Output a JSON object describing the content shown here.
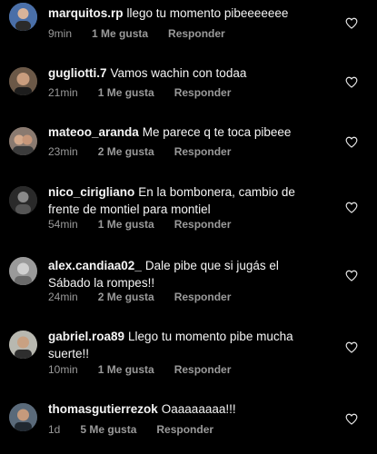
{
  "comments": [
    {
      "username": "marquitos.rp",
      "text": "llego tu momento pibeeeeeee",
      "time": "9min",
      "likes": "1 Me gusta",
      "reply": "Responder"
    },
    {
      "username": "gugliotti.7",
      "text": "Vamos wachin con todaa",
      "time": "21min",
      "likes": "1 Me gusta",
      "reply": "Responder"
    },
    {
      "username": "mateoo_aranda",
      "text": "Me parece q te toca pibeee",
      "time": "23min",
      "likes": "2 Me gusta",
      "reply": "Responder"
    },
    {
      "username": "nico_cirigliano",
      "text": "En la bombonera, cambio de frente de montiel para montiel",
      "time": "54min",
      "likes": "1 Me gusta",
      "reply": "Responder"
    },
    {
      "username": "alex.candiaa02_",
      "text": "Dale pibe que si jugás el Sábado la rompes!!",
      "time": "24min",
      "likes": "2 Me gusta",
      "reply": "Responder"
    },
    {
      "username": "gabriel.roa89",
      "text": "Llego tu momento pibe mucha suerte!!",
      "time": "10min",
      "likes": "1 Me gusta",
      "reply": "Responder"
    },
    {
      "username": "thomasgutierrezok",
      "text": "Oaaaaaaaa!!!",
      "time": "1d",
      "likes": "5 Me gusta",
      "reply": "Responder"
    }
  ],
  "icons": {
    "avatar": "user-avatar",
    "like": "heart-outline-icon"
  },
  "colors": {
    "background": "#000000",
    "text": "#f5f5f5",
    "meta": "#9a9a9a"
  }
}
